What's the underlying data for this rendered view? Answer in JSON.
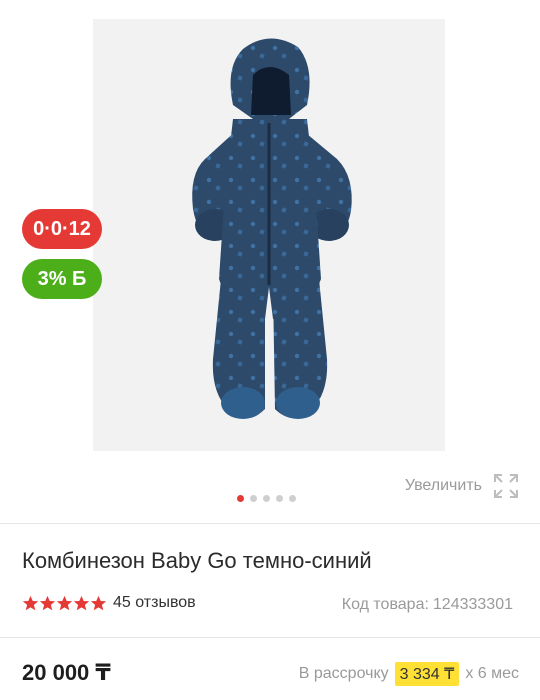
{
  "badges": {
    "installment": "0·0·12",
    "bonus": "3% Б",
    "installment_color": "#e53935",
    "bonus_color": "#4caf1a"
  },
  "gallery": {
    "zoom_label": "Увеличить",
    "total_images": 5,
    "active_index": 0
  },
  "product": {
    "title": "Комбинезон Baby Go темно-синий",
    "rating": 5,
    "reviews": "45 отзывов",
    "sku_label": "Код товара:",
    "sku_value": "124333301",
    "price": "20 000 ₸",
    "installment_label": "В рассрочку",
    "installment_amount": "3 334 ₸",
    "installment_term": "х 6 мес"
  },
  "colors": {
    "accent": "#e53935",
    "star": "#e53935",
    "highlight": "#ffe135"
  }
}
